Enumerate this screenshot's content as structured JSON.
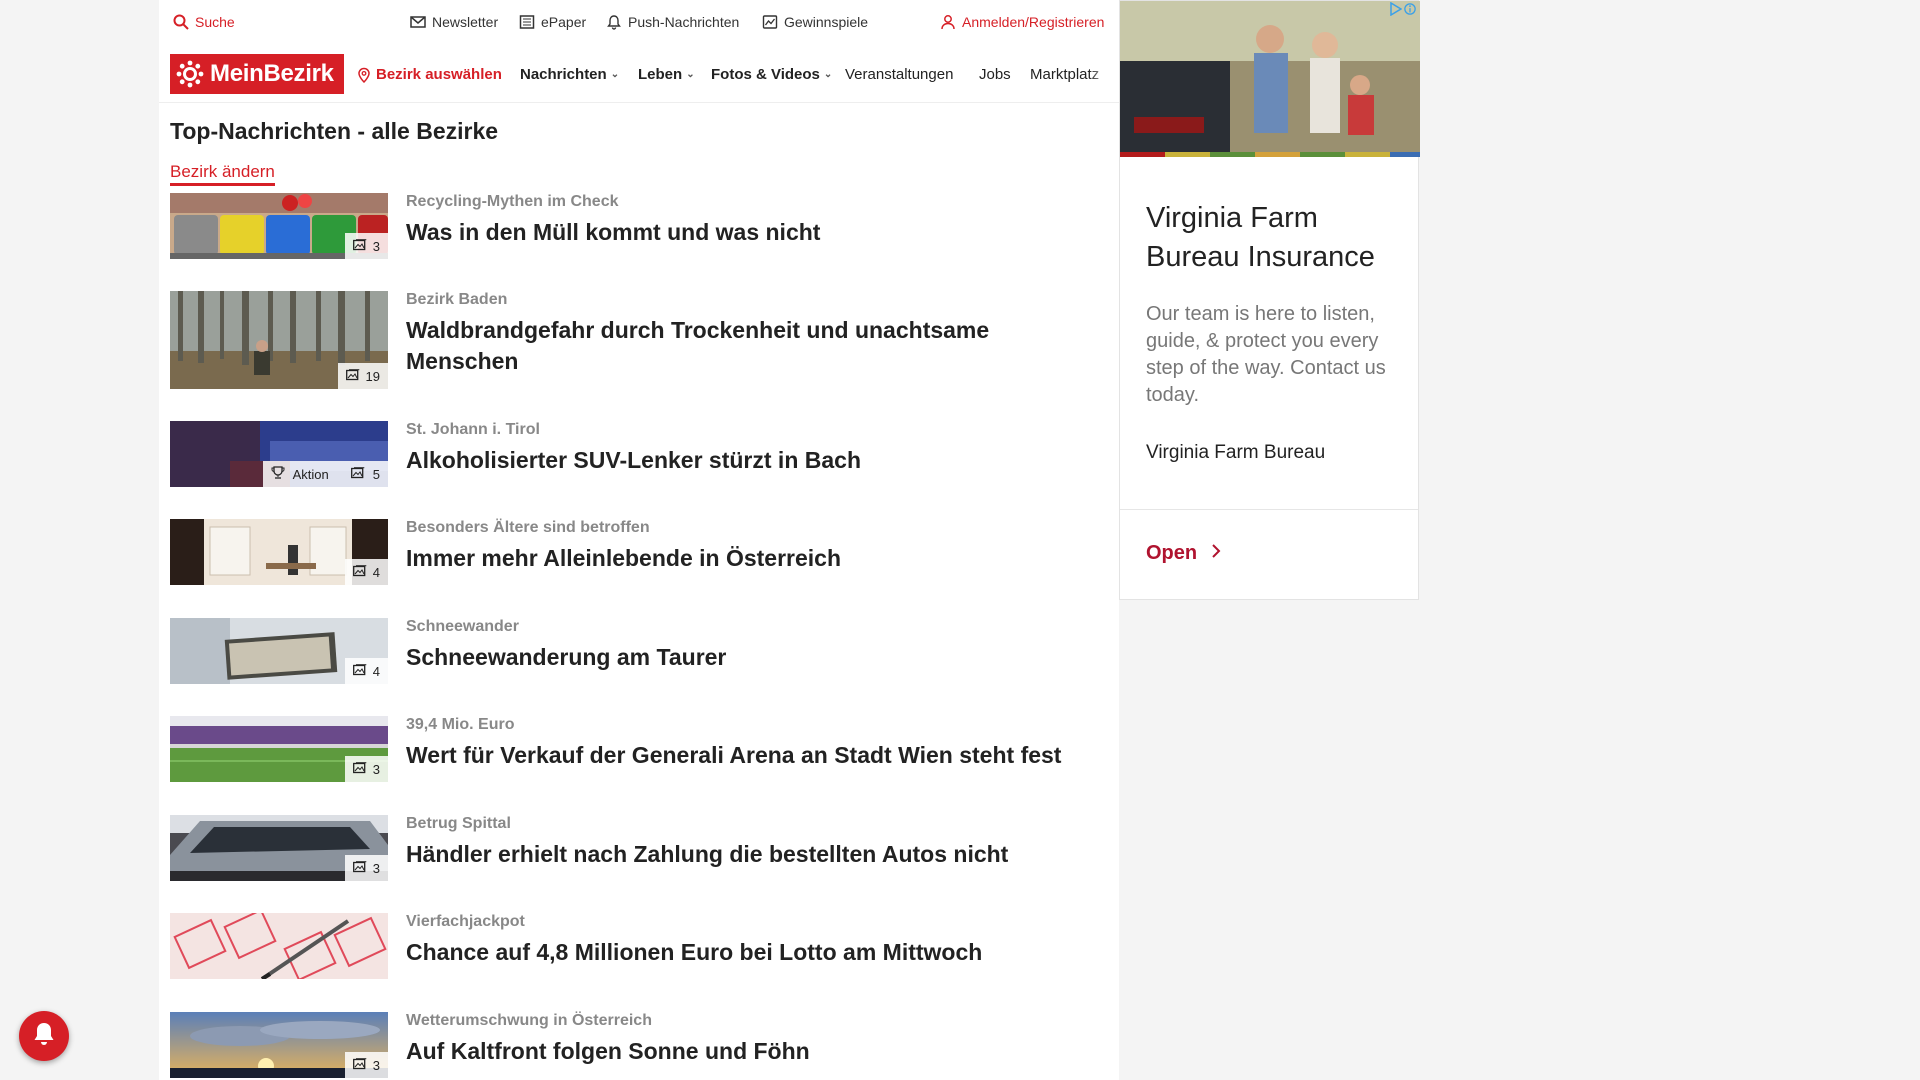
{
  "utilbar": {
    "search": "Suche",
    "newsletter": "Newsletter",
    "epaper": "ePaper",
    "push": "Push-Nachrichten",
    "games": "Gewinnspiele",
    "login": "Anmelden/Registrieren"
  },
  "nav": {
    "logo": "MeinBezirk",
    "district_select": "Bezirk auswählen",
    "items": [
      {
        "label": "Nachrichten"
      },
      {
        "label": "Leben"
      },
      {
        "label": "Fotos & Videos"
      },
      {
        "label": "Veranstaltungen"
      },
      {
        "label": "Jobs"
      },
      {
        "label": "Marktplatz"
      }
    ]
  },
  "content": {
    "title": "Top-Nachrichten - alle Bezirke",
    "change_district": "Bezirk ändern"
  },
  "articles": [
    {
      "kicker": "Recycling-Mythen im Check",
      "headline": "Was in den Müll kommt und was nicht",
      "photo_count": "3"
    },
    {
      "kicker": "Bezirk Baden",
      "headline": "Waldbrandgefahr durch Trockenheit und unachtsame Menschen",
      "photo_count": "19"
    },
    {
      "kicker": "St. Johann i. Tirol",
      "headline": "Alkoholisierter SUV-Lenker stürzt in Bach",
      "photo_count": "5",
      "tag": "Aktion"
    },
    {
      "kicker": "Besonders Ältere sind betroffen",
      "headline": "Immer mehr Alleinlebende in Österreich",
      "photo_count": "4"
    },
    {
      "kicker": "Schneewander",
      "headline": "Schneewanderung am Taurer",
      "photo_count": "4"
    },
    {
      "kicker": "39,4 Mio. Euro",
      "headline": "Wert für Verkauf der Generali Arena an Stadt Wien steht fest",
      "photo_count": "3"
    },
    {
      "kicker": "Betrug Spittal",
      "headline": "Händler erhielt nach Zahlung die bestellten Autos nicht",
      "photo_count": "3"
    },
    {
      "kicker": "Vierfachjackpot",
      "headline": "Chance auf 4,8 Millionen Euro bei Lotto am Mittwoch",
      "photo_count": ""
    },
    {
      "kicker": "Wetterumschwung in Österreich",
      "headline": "Auf Kaltfront folgen Sonne und Föhn",
      "photo_count": "3"
    }
  ],
  "ad": {
    "title": "Virginia Farm Bureau Insurance",
    "body": "Our team is here to listen, guide, & protect you every step of the way. Contact us today.",
    "brand": "Virginia Farm Bureau",
    "cta": "Open"
  },
  "colors": {
    "brand_red": "#d61f26",
    "ad_cta": "#b0132f"
  }
}
